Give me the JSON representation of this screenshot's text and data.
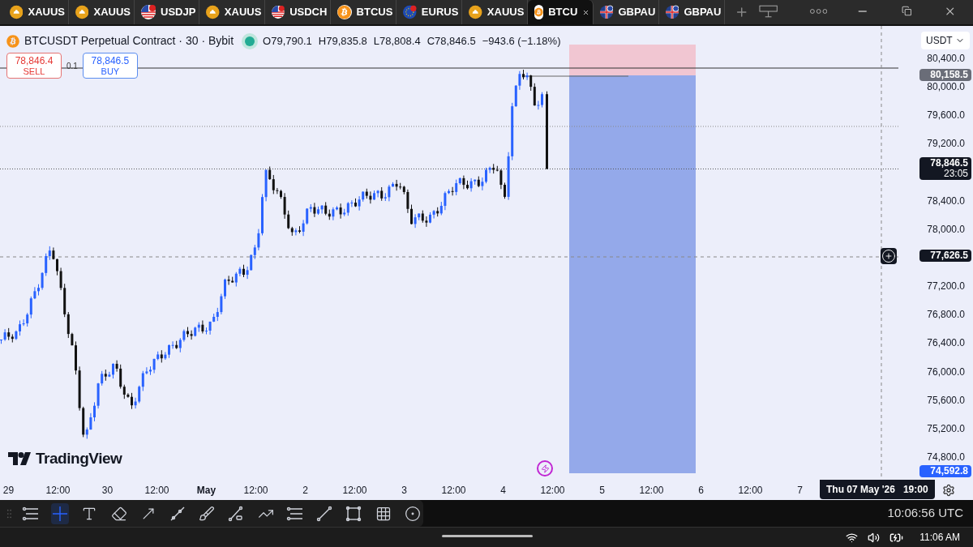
{
  "tabs": [
    {
      "label": "XAUUS",
      "kind": "gold",
      "selected": false
    },
    {
      "label": "XAUUS",
      "kind": "gold",
      "selected": false
    },
    {
      "label": "USDJP",
      "kind": "usd",
      "selected": false
    },
    {
      "label": "XAUUS",
      "kind": "gold",
      "selected": false
    },
    {
      "label": "USDCH",
      "kind": "usd",
      "selected": false
    },
    {
      "label": "BTCUS",
      "kind": "btc",
      "selected": false
    },
    {
      "label": "EURUS",
      "kind": "eur",
      "selected": false
    },
    {
      "label": "XAUUS",
      "kind": "gold",
      "selected": false
    },
    {
      "label": "BTCU",
      "kind": "btc",
      "selected": true
    },
    {
      "label": "GBPAU",
      "kind": "gbp",
      "selected": false
    },
    {
      "label": "GBPAU",
      "kind": "gbp",
      "selected": false
    }
  ],
  "legend": {
    "symbol": "BTCUSDT Perpetual Contract · 30 · Bybit",
    "market_open": true,
    "values": [
      "O79,790.1",
      "H79,835.8",
      "L78,808.4",
      "C78,846.5",
      "−943.6 (−1.18%)"
    ]
  },
  "trade": {
    "sell_price": "78,846.4",
    "sell_label": "SELL",
    "quantity": "0.1",
    "buy_price": "78,846.5",
    "buy_label": "BUY"
  },
  "currency": "USDT",
  "price_axis": {
    "ticks": [
      "80,400.0",
      "80,000.0",
      "79,600.0",
      "79,200.0",
      "78,400.0",
      "78,000.0",
      "77,200.0",
      "76,800.0",
      "76,400.0",
      "76,000.0",
      "75,600.0",
      "75,200.0",
      "74,800.0"
    ],
    "labels": [
      {
        "kind": "line",
        "text": "80,158.5"
      },
      {
        "kind": "last",
        "text": "78,846.5",
        "sub": "23:05"
      },
      {
        "kind": "crosshair",
        "text": "77,626.5"
      },
      {
        "kind": "target",
        "text": "74,592.8"
      }
    ]
  },
  "time_axis": {
    "labels": [
      "29",
      "12:00",
      "30",
      "12:00",
      "May",
      "12:00",
      "2",
      "12:00",
      "3",
      "12:00",
      "4",
      "12:00",
      "5",
      "12:00",
      "6",
      "12:00",
      "7"
    ],
    "crosshair": "Thu 07 May '26   19:00"
  },
  "logo": "TradingView",
  "tools": [
    {
      "kind": "lines",
      "selected": false
    },
    {
      "kind": "crosshair",
      "selected": true
    },
    {
      "kind": "text",
      "selected": false
    },
    {
      "kind": "eraser",
      "selected": false
    },
    {
      "kind": "arrow",
      "selected": false
    },
    {
      "kind": "trend",
      "selected": false
    },
    {
      "kind": "brush",
      "selected": false
    },
    {
      "kind": "path",
      "selected": false
    },
    {
      "kind": "pattern",
      "selected": false
    },
    {
      "kind": "long",
      "selected": false
    },
    {
      "kind": "ray",
      "selected": false
    },
    {
      "kind": "rect",
      "selected": false
    },
    {
      "kind": "grid",
      "selected": false
    },
    {
      "kind": "circle",
      "selected": false
    }
  ],
  "utc_time": "10:06:56 UTC",
  "system_time": "11:06 AM"
}
